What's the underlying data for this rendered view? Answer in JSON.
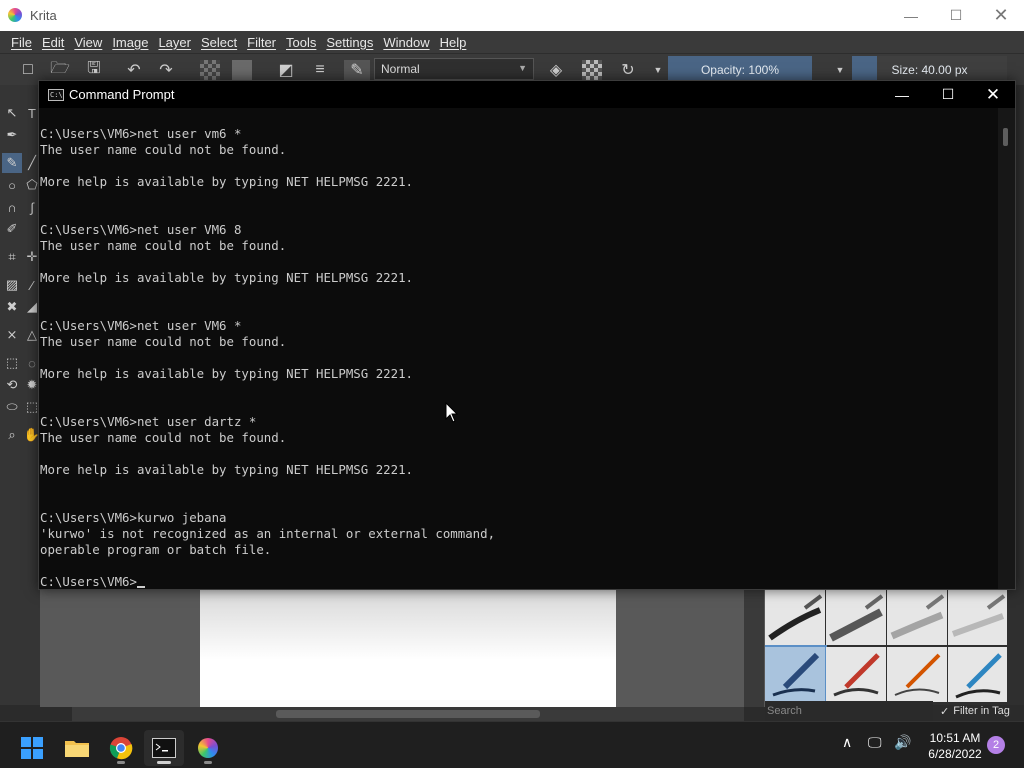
{
  "krita": {
    "title": "Krita",
    "menu": [
      "File",
      "Edit",
      "View",
      "Image",
      "Layer",
      "Select",
      "Filter",
      "Tools",
      "Settings",
      "Window",
      "Help"
    ],
    "blend_mode": "Normal",
    "opacity_label": "Opacity: 100%",
    "size_label": "Size: 40.00 px",
    "brush_search_placeholder": "Search",
    "filter_in_tag_label": "Filter in Tag"
  },
  "cmd": {
    "title": "Command Prompt",
    "lines": [
      "C:\\Users\\VM6>net user vm6 *",
      "The user name could not be found.",
      "",
      "More help is available by typing NET HELPMSG 2221.",
      "",
      "",
      "C:\\Users\\VM6>net user VM6 8",
      "The user name could not be found.",
      "",
      "More help is available by typing NET HELPMSG 2221.",
      "",
      "",
      "C:\\Users\\VM6>net user VM6 *",
      "The user name could not be found.",
      "",
      "More help is available by typing NET HELPMSG 2221.",
      "",
      "",
      "C:\\Users\\VM6>net user dartz *",
      "The user name could not be found.",
      "",
      "More help is available by typing NET HELPMSG 2221.",
      "",
      "",
      "C:\\Users\\VM6>kurwo jebana",
      "'kurwo' is not recognized as an internal or external command,",
      "operable program or batch file.",
      ""
    ],
    "prompt": "C:\\Users\\VM6>"
  },
  "taskbar": {
    "time": "10:51 AM",
    "date": "6/28/2022",
    "notification_count": "2",
    "apps": [
      "start-icon",
      "file-explorer-icon",
      "chrome-icon",
      "command-prompt-icon",
      "krita-icon"
    ]
  }
}
